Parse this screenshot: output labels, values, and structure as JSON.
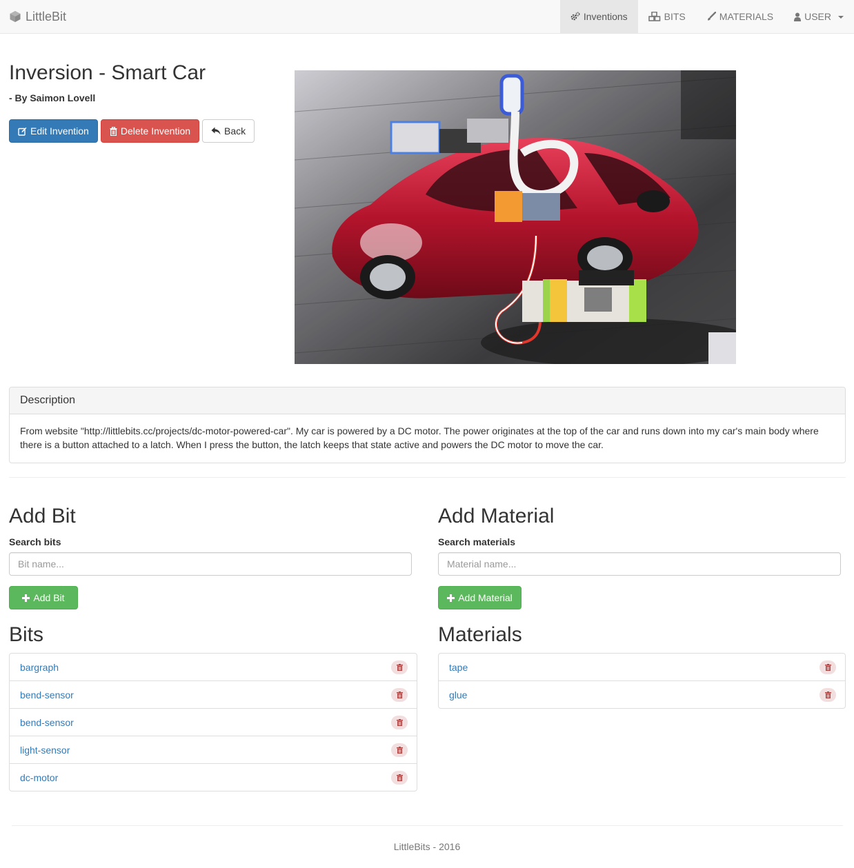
{
  "navbar": {
    "brand": "LittleBit",
    "items": [
      {
        "label": "Inventions",
        "icon": "gears-icon",
        "active": true
      },
      {
        "label": "BITS",
        "icon": "cubes-icon",
        "active": false
      },
      {
        "label": "MATERIALS",
        "icon": "paintbrush-icon",
        "active": false
      },
      {
        "label": "USER",
        "icon": "user-icon",
        "active": false,
        "dropdown": true
      }
    ]
  },
  "invention": {
    "title": "Inversion - Smart Car",
    "author": "- By Saimon Lovell",
    "buttons": {
      "edit": "Edit Invention",
      "delete": "Delete Invention",
      "back": "Back"
    }
  },
  "description": {
    "heading": "Description",
    "text": "From website \"http://littlebits.cc/projects/dc-motor-powered-car\". My car is powered by a DC motor. The power originates at the top of the car and runs down into my car's main body where there is a button attached to a latch. When I press the button, the latch keeps that state active and powers the DC motor to move the car."
  },
  "add_bit": {
    "title": "Add Bit",
    "label": "Search bits",
    "placeholder": "Bit name...",
    "button": "Add Bit"
  },
  "add_material": {
    "title": "Add Material",
    "label": "Search materials",
    "placeholder": "Material name...",
    "button": "Add Material"
  },
  "bits": {
    "title": "Bits",
    "items": [
      "bargraph",
      "bend-sensor",
      "bend-sensor",
      "light-sensor",
      "dc-motor"
    ]
  },
  "materials": {
    "title": "Materials",
    "items": [
      "tape",
      "glue"
    ]
  },
  "footer": "LittleBits - 2016",
  "colors": {
    "primary": "#337ab7",
    "danger": "#d9534f",
    "success": "#5cb85c",
    "delete_icon": "#a94442"
  }
}
